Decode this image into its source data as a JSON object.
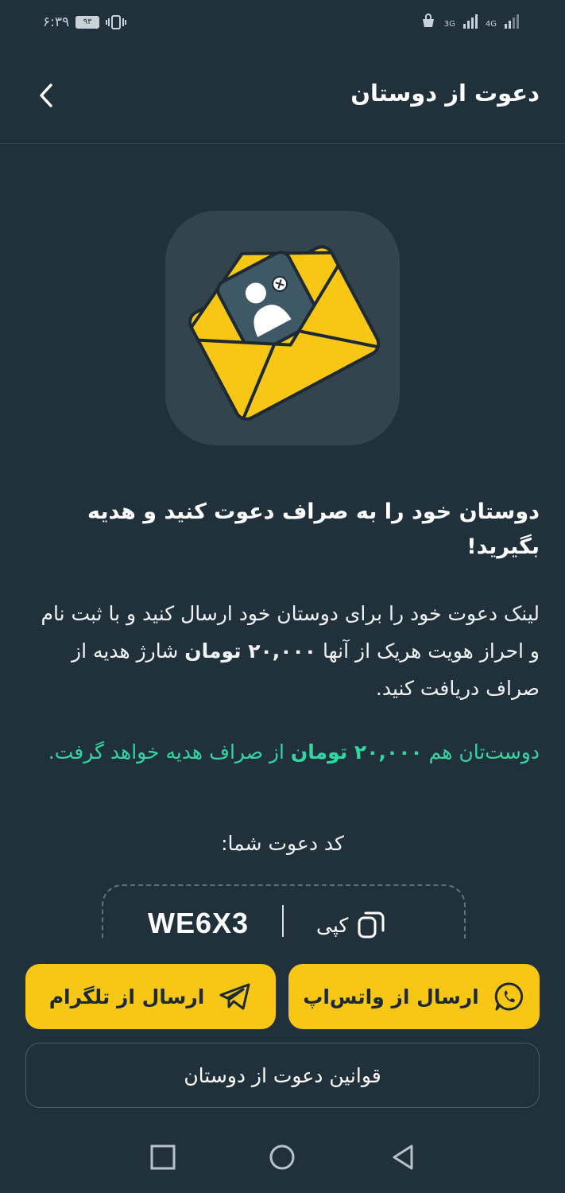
{
  "status_bar": {
    "time": "۶:۳۹",
    "battery": "۹۳",
    "network1": "3G",
    "network2": "4G"
  },
  "header": {
    "title": "دعوت از دوستان"
  },
  "main": {
    "headline": "دوستان خود را به صراف دعوت کنید و هدیه بگیرید!",
    "description_before": "لینک دعوت خود را برای دوستان خود ارسال کنید و با ثبت نام و احراز هویت هریک از آنها",
    "description_amount": "۲۰,۰۰۰ تومان",
    "description_after": "شارژ هدیه از صراف دریافت کنید.",
    "friend_before": "دوست‌تان هم",
    "friend_amount": "۲۰,۰۰۰ تومان",
    "friend_after": "از صراف هدیه خواهد گرفت.",
    "code_label": "کد دعوت شما:",
    "invite_code": "WE6X3",
    "copy_label": "کپی"
  },
  "actions": {
    "whatsapp_label": "ارسال از واتس‌اپ",
    "telegram_label": "ارسال از تلگرام",
    "rules_label": "قوانین دعوت از دوستان"
  },
  "colors": {
    "background": "#21313b",
    "accent_yellow": "#f8c614",
    "accent_green": "#32d6a4"
  },
  "icons": [
    "back-chevron-icon",
    "envelope-invite-icon",
    "copy-icon",
    "whatsapp-icon",
    "telegram-icon",
    "recent-apps-icon",
    "home-icon",
    "back-triangle-icon"
  ]
}
